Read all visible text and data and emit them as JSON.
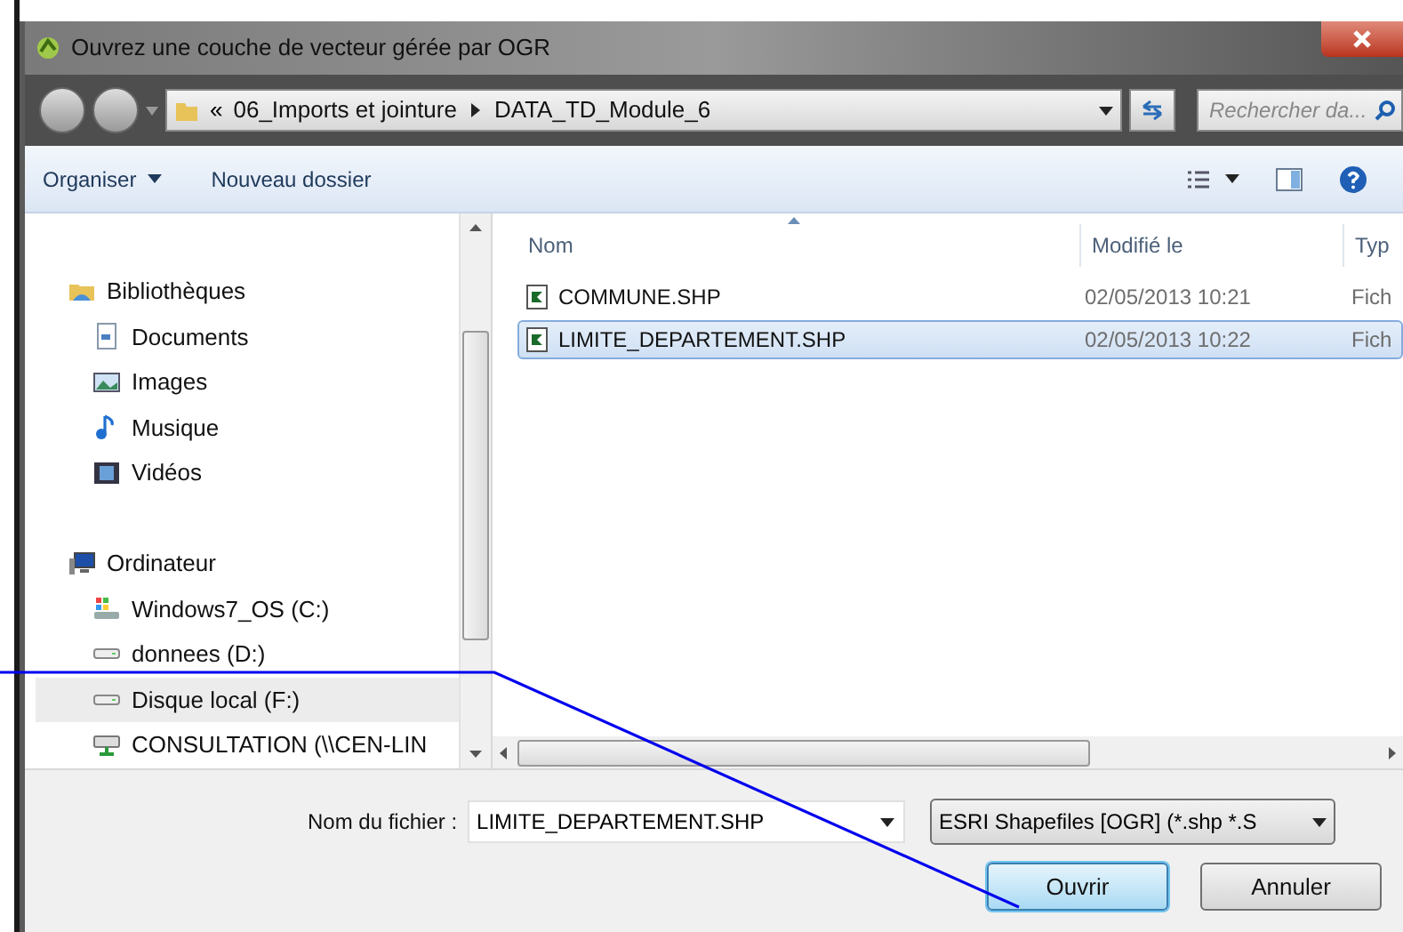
{
  "window": {
    "title": "Ouvrez une couche de vecteur gérée par OGR"
  },
  "address": {
    "overflow": "«",
    "path": [
      "06_Imports et jointure",
      "DATA_TD_Module_6"
    ]
  },
  "search": {
    "placeholder": "Rechercher da..."
  },
  "toolbar": [
    {
      "label": "Organiser",
      "kind": "menu"
    },
    {
      "label": "Nouveau dossier",
      "kind": "plain"
    }
  ],
  "navigation": [
    {
      "label": "Bibliothèques",
      "kind": "library",
      "selected": false,
      "children": [
        {
          "label": "Documents",
          "kind": "document",
          "selected": false
        },
        {
          "label": "Images",
          "kind": "image",
          "selected": false
        },
        {
          "label": "Musique",
          "kind": "music",
          "selected": false
        },
        {
          "label": "Vidéos",
          "kind": "video",
          "selected": false
        }
      ]
    },
    {
      "label": "Ordinateur",
      "kind": "computer",
      "selected": false,
      "children": [
        {
          "label": "Windows7_OS (C:)",
          "kind": "osdrive",
          "selected": false
        },
        {
          "label": "donnees (D:)",
          "kind": "drive",
          "selected": false
        },
        {
          "label": "Disque local (F:)",
          "kind": "drive",
          "selected": true
        },
        {
          "label": "CONSULTATION (\\\\CEN-LIN",
          "kind": "netdrive",
          "selected": false
        }
      ]
    }
  ],
  "file_list": {
    "columns": [
      "Nom",
      "Modifié le",
      "Typ"
    ],
    "rows": [
      {
        "name": "COMMUNE.SHP",
        "modified": "02/05/2013 10:21",
        "type": "Fich",
        "selected": false
      },
      {
        "name": "LIMITE_DEPARTEMENT.SHP",
        "modified": "02/05/2013 10:22",
        "type": "Fich",
        "selected": true
      }
    ]
  },
  "filename": {
    "label": "Nom du fichier :",
    "value": "LIMITE_DEPARTEMENT.SHP"
  },
  "filter": {
    "value": "ESRI Shapefiles [OGR] (*.shp *.S"
  },
  "buttons": [
    {
      "label": "Ouvrir",
      "default": true
    },
    {
      "label": "Annuler",
      "default": false
    }
  ]
}
